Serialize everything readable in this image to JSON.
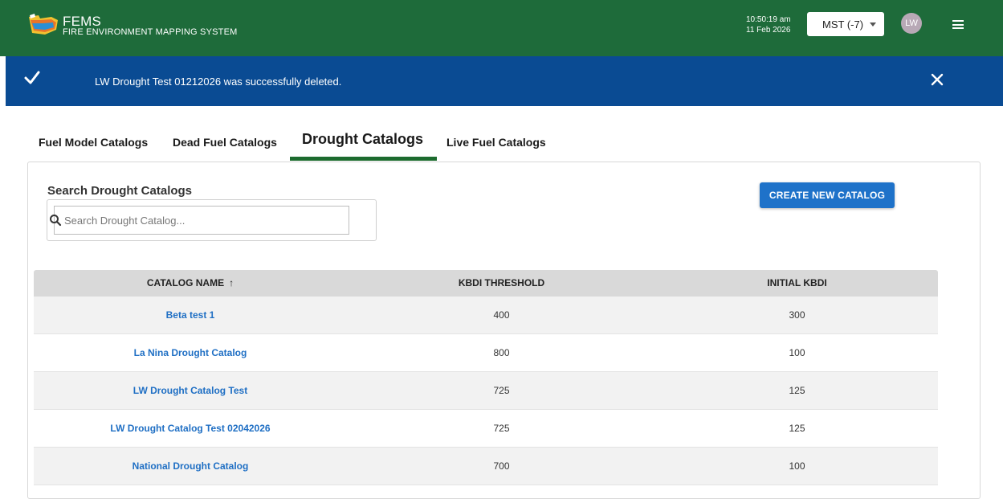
{
  "header": {
    "app_short": "FEMS",
    "app_full": "FIRE ENVIRONMENT MAPPING SYSTEM",
    "time": "10:50:19 am",
    "date": "11 Feb 2026",
    "timezone": "MST (-7)",
    "avatar_initials": "LW",
    "menu_icon": "hamburger-menu-icon"
  },
  "notification": {
    "message": "LW Drought Test 01212026 was successfully deleted.",
    "status_icon": "check-icon",
    "close_icon": "close-icon"
  },
  "tabs": [
    {
      "label": "Fuel Model Catalogs",
      "active": false
    },
    {
      "label": "Dead Fuel Catalogs",
      "active": false
    },
    {
      "label": "Drought Catalogs",
      "active": true
    },
    {
      "label": "Live Fuel Catalogs",
      "active": false
    }
  ],
  "search": {
    "heading": "Search Drought Catalogs",
    "placeholder": "Search Drought Catalog...",
    "value": ""
  },
  "create_button": "CREATE NEW CATALOG",
  "table": {
    "columns": [
      "CATALOG NAME",
      "KBDI THRESHOLD",
      "INITIAL KBDI"
    ],
    "sort_indicator": "↑",
    "rows": [
      {
        "name": "Beta test 1",
        "threshold": "400",
        "initial": "300"
      },
      {
        "name": "La Nina Drought Catalog",
        "threshold": "800",
        "initial": "100"
      },
      {
        "name": "LW Drought Catalog Test",
        "threshold": "725",
        "initial": "125"
      },
      {
        "name": "LW Drought Catalog Test 02042026",
        "threshold": "725",
        "initial": "125"
      },
      {
        "name": "National Drought Catalog",
        "threshold": "700",
        "initial": "100"
      }
    ]
  },
  "colors": {
    "header_bg": "#1e6b3a",
    "notice_bg": "#0a4b93",
    "primary_button": "#1e72c9",
    "link": "#1f6fc4",
    "tab_underline": "#1c6b2e"
  }
}
